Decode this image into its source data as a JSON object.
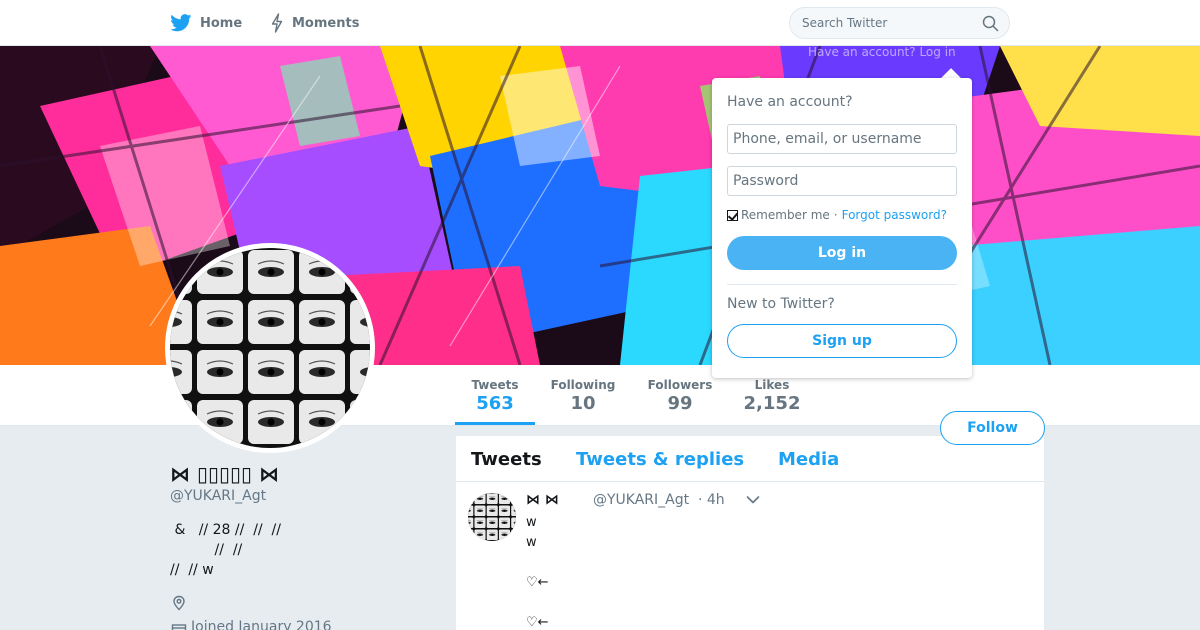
{
  "nav": {
    "home_label": "Home",
    "moments_label": "Moments",
    "search_placeholder": "Search Twitter",
    "brand_color": "#1da1f2"
  },
  "login_hint": "Have an account? Log in",
  "login": {
    "heading": "Have an account?",
    "username_placeholder": "Phone, email, or username",
    "password_placeholder": "Password",
    "remember_label": "Remember me",
    "remember_checked": true,
    "separator": "·",
    "forgot_label": "Forgot password?",
    "login_button": "Log in",
    "new_heading": "New to Twitter?",
    "signup_button": "Sign up"
  },
  "stats": {
    "tweets_label": "Tweets",
    "tweets_value": "563",
    "following_label": "Following",
    "following_value": "10",
    "followers_label": "Followers",
    "followers_value": "99",
    "likes_label": "Likes",
    "likes_value": "2,152"
  },
  "follow_button": "Follow",
  "profile": {
    "name": "⋈ ▯▯▯▯▯ ⋈",
    "handle": "@YUKARI_Agt",
    "bio": " &   // 28 //  //  //\n          //  //\n//  // w",
    "joined": "Joined January 2016"
  },
  "timeline_tabs": {
    "tweets": "Tweets",
    "replies": "Tweets & replies",
    "media": "Media"
  },
  "tweet": {
    "name": "⋈  ⋈",
    "handle": "@YUKARI_Agt",
    "time": "· 4h",
    "text": "w\nw\n\n♡←\n\n♡←"
  }
}
